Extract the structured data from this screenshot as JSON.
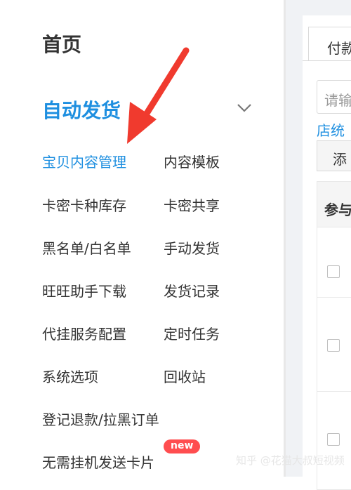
{
  "sidebar": {
    "home": "首页",
    "section_title": "自动发货",
    "items": [
      {
        "label": "宝贝内容管理",
        "active": true
      },
      {
        "label": "内容模板"
      },
      {
        "label": "卡密卡种库存"
      },
      {
        "label": "卡密共享"
      },
      {
        "label": "黑名单/白名单"
      },
      {
        "label": "手动发货"
      },
      {
        "label": "旺旺助手下载"
      },
      {
        "label": "发货记录"
      },
      {
        "label": "代挂服务配置"
      },
      {
        "label": "定时任务"
      },
      {
        "label": "系统选项"
      },
      {
        "label": "回收站"
      },
      {
        "label": "登记退款/拉黑订单"
      },
      {
        "label": "无需挂机发送卡片"
      }
    ],
    "new_badge": "new"
  },
  "main": {
    "tab": "付款",
    "search_placeholder": "请输",
    "shop_link": "店统",
    "add_button": "添",
    "table_header": "参与"
  },
  "watermark": "知乎 @花猫大叔短视频",
  "colors": {
    "accent": "#1e8fe0",
    "arrow": "#f03a2e",
    "badge": "#ff4d4f"
  }
}
